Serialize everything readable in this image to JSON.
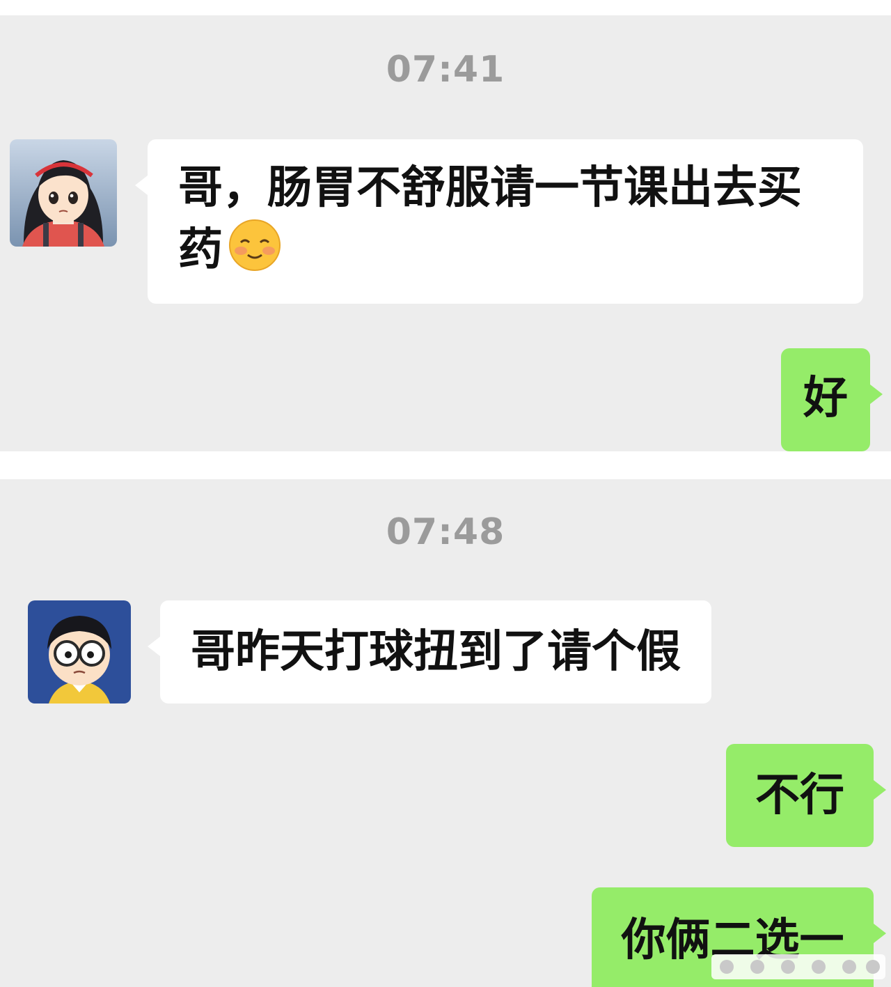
{
  "screenshot_1": {
    "timestamp": "07:41",
    "messages": [
      {
        "side": "received",
        "avatar": "girl-avatar",
        "text": "哥，肠胃不舒服请一节课出去买药",
        "emoji": "slightly-smiling-blushing-emoji"
      },
      {
        "side": "sent",
        "text": "好"
      }
    ]
  },
  "screenshot_2": {
    "timestamp": "07:48",
    "messages": [
      {
        "side": "received",
        "avatar": "boy-glasses-avatar",
        "text": "哥昨天打球扭到了请个假"
      },
      {
        "side": "sent",
        "text": "不行"
      },
      {
        "side": "sent",
        "text": "你俩二选一"
      }
    ]
  },
  "colors": {
    "chat_background": "#ededed",
    "received_bubble": "#ffffff",
    "sent_bubble": "#95ec69",
    "timestamp_text": "#9b9b9b"
  }
}
